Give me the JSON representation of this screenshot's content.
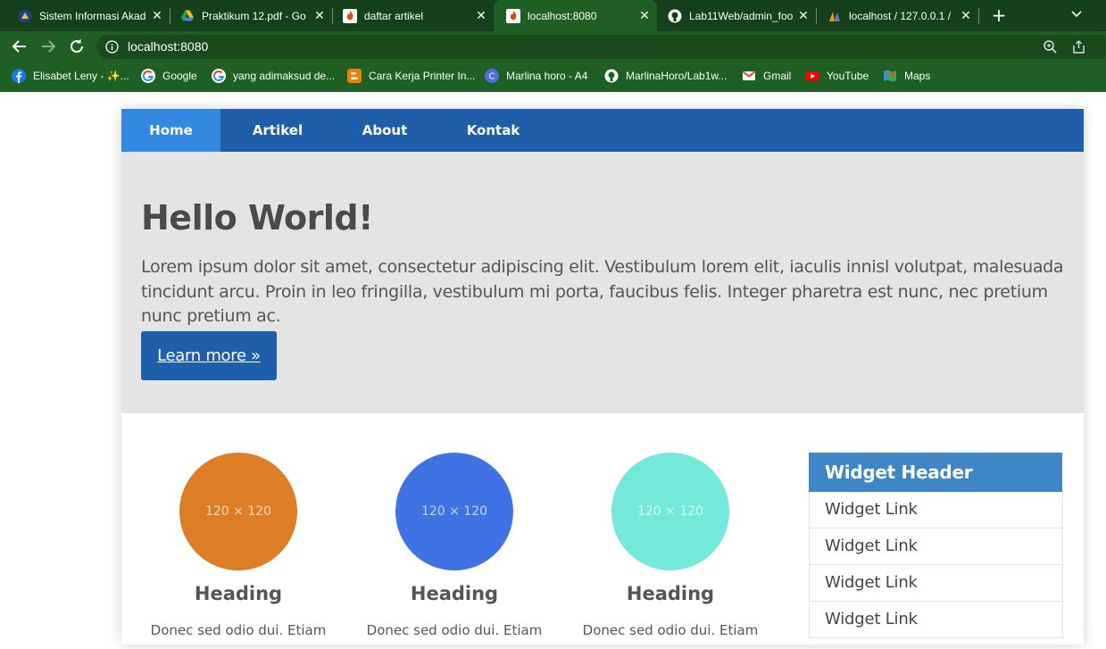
{
  "browser": {
    "tabs": [
      {
        "title": "Sistem Informasi Akad",
        "icon": "campus-logo-icon",
        "active": false
      },
      {
        "title": "Praktikum 12.pdf - Go",
        "icon": "google-drive-icon",
        "active": false
      },
      {
        "title": "daftar artikel",
        "icon": "codeigniter-flame-icon",
        "active": false
      },
      {
        "title": "localhost:8080",
        "icon": "codeigniter-flame-icon",
        "active": true
      },
      {
        "title": "Lab11Web/admin_foo",
        "icon": "github-icon",
        "active": false
      },
      {
        "title": "localhost / 127.0.0.1 /",
        "icon": "phpmyadmin-sail-icon",
        "active": false
      }
    ],
    "address": {
      "url": "localhost:8080"
    },
    "bookmarks": [
      {
        "label": "Elisabet Leny - ✨...",
        "icon": "facebook-icon"
      },
      {
        "label": "Google",
        "icon": "google-icon"
      },
      {
        "label": "yang adimaksud de...",
        "icon": "google-icon"
      },
      {
        "label": "Cara Kerja Printer In...",
        "icon": "blogger-icon"
      },
      {
        "label": "Marlina horo - A4",
        "icon": "canva-icon"
      },
      {
        "label": "MarlinaHoro/Lab1w...",
        "icon": "github-icon"
      },
      {
        "label": "Gmail",
        "icon": "gmail-icon"
      },
      {
        "label": "YouTube",
        "icon": "youtube-icon"
      },
      {
        "label": "Maps",
        "icon": "maps-icon"
      }
    ]
  },
  "site": {
    "nav": [
      {
        "label": "Home",
        "active": true
      },
      {
        "label": "Artikel",
        "active": false
      },
      {
        "label": "About",
        "active": false
      },
      {
        "label": "Kontak",
        "active": false
      }
    ],
    "hero": {
      "title": "Hello World!",
      "text": "Lorem ipsum dolor sit amet, consectetur adipiscing elit. Vestibulum lorem elit, iaculis innisl volutpat, malesuada tincidunt arcu. Proin in leo fringilla, vestibulum mi porta, faucibus felis. Integer pharetra est nunc, nec pretium nunc pretium ac.",
      "button": "Learn more »"
    },
    "features": [
      {
        "placeholder": "120 × 120",
        "color": "#dd7d26",
        "heading": "Heading",
        "text": "Donec sed odio dui. Etiam"
      },
      {
        "placeholder": "120 × 120",
        "color": "#3f72e4",
        "heading": "Heading",
        "text": "Donec sed odio dui. Etiam"
      },
      {
        "placeholder": "120 × 120",
        "color": "#74e8d9",
        "heading": "Heading",
        "text": "Donec sed odio dui. Etiam"
      }
    ],
    "widget": {
      "header": "Widget Header",
      "links": [
        "Widget Link",
        "Widget Link",
        "Widget Link",
        "Widget Link"
      ]
    }
  },
  "colors": {
    "browser_frame": "#1f5f24",
    "site_nav": "#1f5fa9",
    "site_nav_active": "#3388e0",
    "hero_bg": "#e4e4e4",
    "widget_header": "#3f86c9"
  }
}
